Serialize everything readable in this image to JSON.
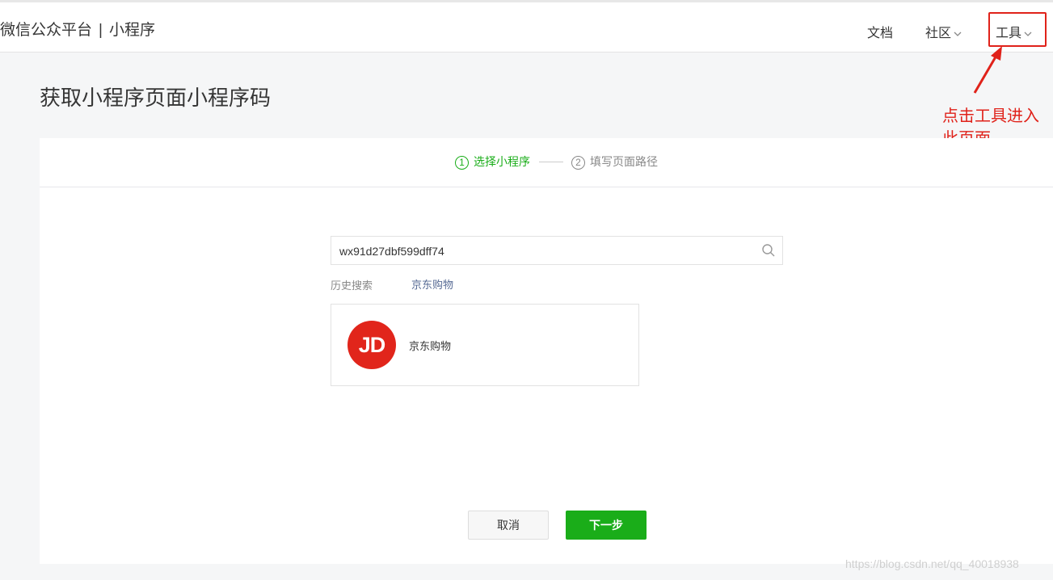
{
  "header": {
    "brand": "微信公众平台",
    "separator": "|",
    "product": "小程序",
    "nav": {
      "docs": "文档",
      "community": "社区",
      "tools": "工具"
    }
  },
  "annotation": {
    "text": "点击工具进入此页面",
    "color": "#e0221a"
  },
  "page": {
    "title": "获取小程序页面小程序码"
  },
  "steps": [
    {
      "num": "1",
      "label": "选择小程序",
      "active": true
    },
    {
      "num": "2",
      "label": "填写页面路径",
      "active": false
    }
  ],
  "search": {
    "value": "wx91d27dbf599dff74",
    "icon": "search-icon"
  },
  "history": {
    "label": "历史搜索",
    "items": [
      "京东购物"
    ]
  },
  "result": {
    "avatar_text": "JD",
    "avatar_color": "#e1251b",
    "name": "京东购物"
  },
  "buttons": {
    "cancel": "取消",
    "next": "下一步"
  },
  "colors": {
    "accent": "#1aad19",
    "link": "#576b95"
  },
  "watermark": "https://blog.csdn.net/qq_40018938"
}
